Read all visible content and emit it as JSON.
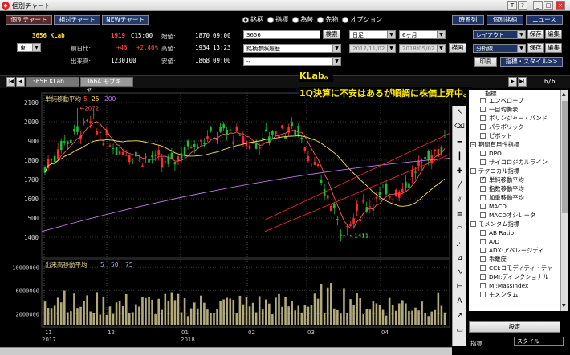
{
  "window": {
    "title": "個別チャート",
    "icon": "app-icon",
    "buttons": [
      "T",
      "?",
      "_",
      "□",
      "×"
    ]
  },
  "top_tabs": [
    {
      "label": "個別チャート"
    },
    {
      "label": "相対チャート"
    },
    {
      "label": "NEWチャート"
    }
  ],
  "security_type": {
    "options": [
      "銘柄",
      "指標",
      "為替",
      "先物",
      "オプション"
    ],
    "selected": "銘柄"
  },
  "right_top_buttons": [
    "時系列",
    "個別銘柄",
    "ニュース"
  ],
  "stock": {
    "code_name": "3656 KLab",
    "price": "1919",
    "time": "C15:00",
    "change_label": "前日比:",
    "change": "+46",
    "change_pct": "+2.46%",
    "volume_label": "出来高:",
    "volume": "1230100",
    "open_label": "始値:",
    "open": "1870",
    "open_time": "09:00",
    "high_label": "高値:",
    "high": "1934",
    "high_time": "13:23",
    "low_label": "安値:",
    "low": "1868",
    "low_time": "09:00",
    "market": "東"
  },
  "search": {
    "code": "3656",
    "search_label": "検索",
    "history": "銘柄参照履歴",
    "third": "--"
  },
  "period": {
    "interval": "日足",
    "range": "6ヶ月",
    "date_from": "2017/11/02",
    "date_to": "2018/05/02",
    "draw_label": "描画"
  },
  "layout": {
    "layout_label": "レイアウト",
    "save": "保存",
    "edit": "編集",
    "divide_label": "分析線",
    "print": "印刷",
    "indicator_style": "指標・スタイル>>"
  },
  "stock_tabs": [
    {
      "label": "3656 KLab"
    },
    {
      "label": "3664 モブキャ..."
    }
  ],
  "page_counter": "6/6",
  "annotation": {
    "line1": "KLab。",
    "line2": "1Q決算に不安はあるが順調に株価上昇中。"
  },
  "indicators": {
    "price_ma_title": "単純移動平均",
    "price_ma_periods": [
      "5",
      "25",
      "200"
    ],
    "vol_ma_title": "出来高移動平均",
    "vol_ma_periods": [
      "5",
      "50",
      "75"
    ],
    "high_note": "←2072",
    "low_note": "←1411"
  },
  "chart_data": [
    {
      "type": "candlestick",
      "title": "",
      "ylim": [
        1300,
        2100
      ],
      "yticks": [
        "2100",
        "2000",
        "1900",
        "1800",
        "1700",
        "1600",
        "1500",
        "1400"
      ],
      "x_ticks": [
        "11",
        "12",
        "01",
        "02",
        "03",
        "04"
      ],
      "year_labels": [
        "2017",
        "2018"
      ],
      "max_point": 2072,
      "min_point": 1411
    },
    {
      "type": "bar",
      "ylim": [
        0,
        11000000
      ],
      "yticks": [
        "10000000",
        "6000000",
        "2000000"
      ]
    }
  ],
  "indicator_tree": [
    {
      "kind": "item",
      "label": "エンベロープ",
      "checked": false
    },
    {
      "kind": "item",
      "label": "一目均衡表",
      "checked": false
    },
    {
      "kind": "item",
      "label": "ボリンジャー・バンド",
      "checked": false
    },
    {
      "kind": "item",
      "label": "パラボリック",
      "checked": false
    },
    {
      "kind": "item",
      "label": "ピボット",
      "checked": false
    },
    {
      "kind": "group",
      "label": "期間有用性指標"
    },
    {
      "kind": "item",
      "label": "DPO",
      "checked": false
    },
    {
      "kind": "item",
      "label": "サイコロジカルライン",
      "checked": false
    },
    {
      "kind": "group",
      "label": "テクニカル指標"
    },
    {
      "kind": "item",
      "label": "単純移動平均",
      "checked": true
    },
    {
      "kind": "item",
      "label": "指数移動平均",
      "checked": false
    },
    {
      "kind": "item",
      "label": "加重移動平均",
      "checked": false
    },
    {
      "kind": "item",
      "label": "MACD",
      "checked": false
    },
    {
      "kind": "item",
      "label": "MACDオシレータ",
      "checked": false
    },
    {
      "kind": "group",
      "label": "モメンタム指標"
    },
    {
      "kind": "item",
      "label": "AB Ratio",
      "checked": false
    },
    {
      "kind": "item",
      "label": "A/D",
      "checked": false
    },
    {
      "kind": "item",
      "label": "ADX:アベレージディ",
      "checked": false
    },
    {
      "kind": "item",
      "label": "乖離度",
      "checked": false
    },
    {
      "kind": "item",
      "label": "CCI:コモディティ・チャ",
      "checked": false
    },
    {
      "kind": "item",
      "label": "DMI:ディレクショナル",
      "checked": false
    },
    {
      "kind": "item",
      "label": "MI:MassIndex",
      "checked": false
    },
    {
      "kind": "item",
      "label": "モメンタム",
      "checked": false
    }
  ],
  "tree_header": "指標",
  "settings_label": "設定",
  "bottom": {
    "left_label": "指標",
    "right_label": "スタイル"
  },
  "colors": {
    "up": "#ff2a2a",
    "down": "#19c03a",
    "ma5": "#ff5a5a",
    "ma25": "#ffe14a",
    "ma200": "#c27ae8",
    "vol": "#b2aa7a"
  }
}
